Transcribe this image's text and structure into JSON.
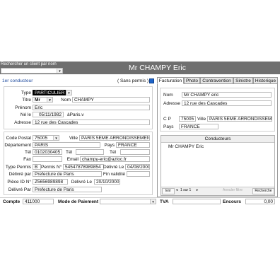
{
  "search": {
    "label": "Rechercher un client par nom",
    "value": ""
  },
  "title": "Mr CHAMPY Eric",
  "toolbar": {
    "first_driver": "1er conducteur",
    "no_license": "( Sans permis )"
  },
  "tabs": [
    "Facturation",
    "Photo",
    "Contravention",
    "Sinistre",
    "Historique"
  ],
  "form": {
    "type_label": "Type",
    "type_value": "PARTICULIER",
    "titre_label": "Titre",
    "titre_value": "Mr",
    "nom_label": "Nom",
    "nom_value": "CHAMPY",
    "prenom_label": "Prénom",
    "prenom_value": "Eric",
    "ne_le_label": "Né le",
    "ne_le_value": "05/11/1982",
    "birth_place": "àParis.v",
    "adresse_label": "Adresse",
    "adresse_value": "12 rue des Cascades",
    "cp_label": "Code Postal",
    "cp_value": "75005",
    "ville_label": "Ville",
    "ville_value": "PARIS 5EME ARRONDISSEMENT",
    "dept_label": "Département",
    "dept_value": "PARIS",
    "pays_label": "Pays",
    "pays_value": "FRANCE",
    "tel_label": "Tél",
    "tel_value": "0102030405",
    "tel2_label": "Tél",
    "tel2_value": "",
    "tel3_label": "Tél",
    "tel3_value": "",
    "fax_label": "Fax",
    "fax_value": "",
    "email_label": "Email",
    "email_value": "champy-eric@azloc.fr",
    "type_permis_label": "Type Permis",
    "type_permis_value": "B",
    "permis_no_label": "Permis N°",
    "permis_no_value": "54547878989854",
    "delivre_le_label": "Délivré Le",
    "delivre_le_value": "04/08/2000",
    "delivre_par_label": "Délivré par",
    "delivre_par_value": "Prefecture de Paris",
    "fin_validite_label": "Fin validité",
    "fin_validite_value": "",
    "piece_id_label": "Pièce ID N°",
    "piece_id_value": "Z5656989898",
    "piece_delivre_le_label": "Délivré Le",
    "piece_delivre_le_value": "20/10/2000",
    "piece_delivre_par_label": "Délivré Par",
    "piece_delivre_par_value": "Prefecture de Paris"
  },
  "billing": {
    "nom_label": "Nom",
    "nom_value": "Mr CHAMPY eric",
    "adresse_label": "Adresse",
    "adresse_value": "12 rue des Cascades",
    "cp_label": "C P",
    "cp_value": "75005",
    "ville_label": "Ville",
    "ville_value": "PARIS 5EME ARRONDISSEME",
    "pays_label": "Pays",
    "pays_value": "FRANCE"
  },
  "drivers": {
    "header": "Conducteurs",
    "items": [
      "Mr CHAMPY Eric"
    ],
    "pager": "1 sur 1",
    "first_btn": "Enr",
    "nav_prev": "◂",
    "nav_next": "▸",
    "search_btn": "Recherche",
    "faded_btn": "Annuler filtre"
  },
  "footer": {
    "compte_label": "Compte",
    "compte_value": "411000",
    "paiement_label": "Mode de Paiement",
    "paiement_value": "",
    "tva_label": "TVA",
    "tva_value": "",
    "encours_label": "Encours",
    "encours_value": "0,00"
  },
  "colors": {
    "titlebar": "#6f6f6f",
    "accent": "#1e64c8",
    "selected_bg": "#000000"
  }
}
